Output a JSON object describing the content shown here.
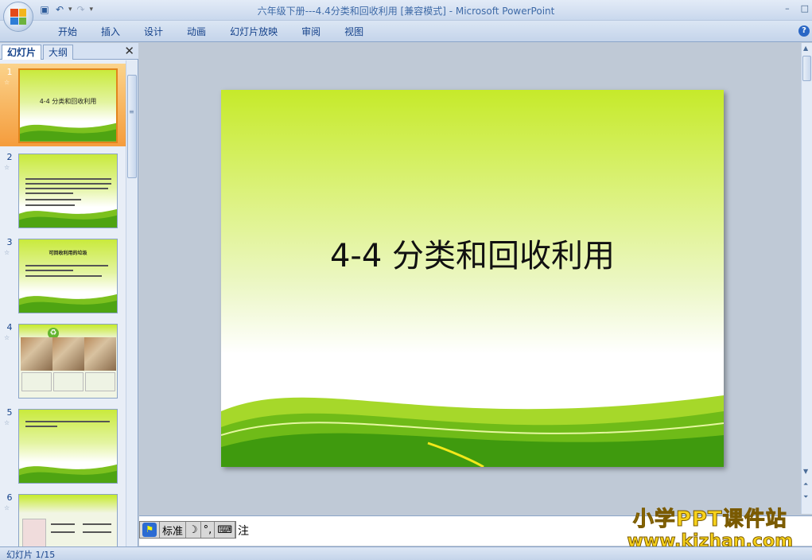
{
  "window": {
    "title": "六年级下册---4.4分类和回收利用 [兼容模式] - Microsoft PowerPoint",
    "controls": [
      "–",
      "□"
    ]
  },
  "quick_access": {
    "save_icon": "save-icon",
    "undo_icon": "undo-icon",
    "redo_icon": "redo-icon"
  },
  "ribbon": {
    "tabs": [
      "开始",
      "插入",
      "设计",
      "动画",
      "幻灯片放映",
      "审阅",
      "视图"
    ],
    "help": "?"
  },
  "left_pane": {
    "tabs": {
      "slides": "幻灯片",
      "outline": "大纲"
    },
    "close": "✕",
    "thumbnails": [
      {
        "number": "1",
        "star": "☆",
        "title": "4-4 分类和回收利用",
        "selected": true
      },
      {
        "number": "2",
        "star": "☆",
        "title": ""
      },
      {
        "number": "3",
        "star": "☆",
        "title": "可回收利用的垃圾"
      },
      {
        "number": "4",
        "star": "☆",
        "title": ""
      },
      {
        "number": "5",
        "star": "☆",
        "title": ""
      },
      {
        "number": "6",
        "star": "☆",
        "title": ""
      }
    ]
  },
  "slide": {
    "title": "4-4 分类和回收利用"
  },
  "notes": {
    "text": "注",
    "ime": {
      "mode": "标准",
      "logo": "⚑"
    }
  },
  "watermark": {
    "line1": "小学PPT课件站",
    "line2": "www.kjzhan.com"
  },
  "status": {
    "slide_counter": "幻灯片 1/15"
  },
  "colors": {
    "slide_green": "#c6ea2a",
    "selection_orange": "#f59c3c",
    "ribbon_blue": "#c4d4ea"
  }
}
